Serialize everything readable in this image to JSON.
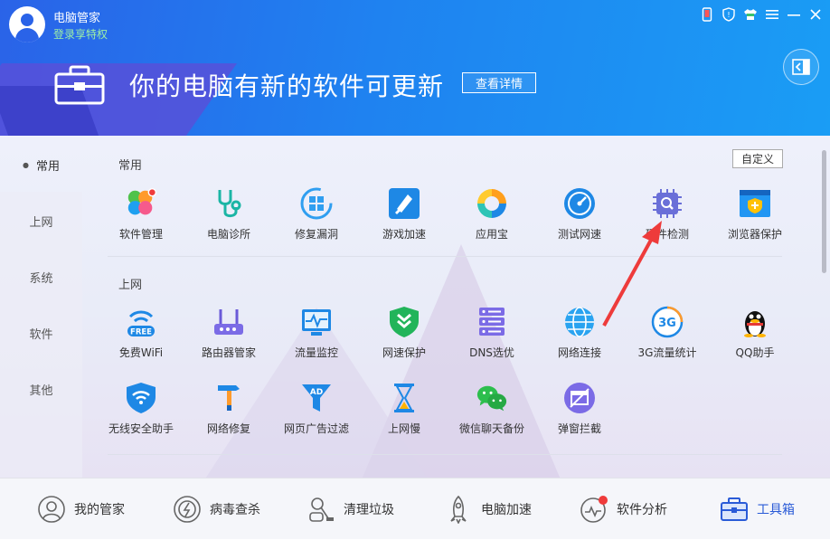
{
  "header": {
    "app_title": "电脑管家",
    "login_link": "登录享特权",
    "headline": "你的电脑有新的软件可更新",
    "detail_button": "查看详情"
  },
  "sidebar": {
    "items": [
      {
        "label": "常用",
        "active": true
      },
      {
        "label": "上网"
      },
      {
        "label": "系统"
      },
      {
        "label": "软件"
      },
      {
        "label": "其他"
      }
    ]
  },
  "main": {
    "custom_button": "自定义",
    "sections": [
      {
        "title": "常用",
        "tools": [
          {
            "label": "软件管理",
            "icon": "software-manager-icon"
          },
          {
            "label": "电脑诊所",
            "icon": "stethoscope-icon"
          },
          {
            "label": "修复漏洞",
            "icon": "windows-repair-icon"
          },
          {
            "label": "游戏加速",
            "icon": "game-boost-icon"
          },
          {
            "label": "应用宝",
            "icon": "app-store-icon"
          },
          {
            "label": "测试网速",
            "icon": "speedometer-icon"
          },
          {
            "label": "硬件检测",
            "icon": "chip-search-icon"
          },
          {
            "label": "浏览器保护",
            "icon": "browser-shield-icon"
          }
        ]
      },
      {
        "title": "上网",
        "tools": [
          {
            "label": "免费WiFi",
            "icon": "free-wifi-icon",
            "badge": "FREE"
          },
          {
            "label": "路由器管家",
            "icon": "router-icon"
          },
          {
            "label": "流量监控",
            "icon": "traffic-monitor-icon"
          },
          {
            "label": "网速保护",
            "icon": "speed-shield-icon"
          },
          {
            "label": "DNS选优",
            "icon": "dns-server-icon"
          },
          {
            "label": "网络连接",
            "icon": "globe-icon"
          },
          {
            "label": "3G流量统计",
            "icon": "3g-icon",
            "badge": "3G"
          },
          {
            "label": "QQ助手",
            "icon": "qq-penguin-icon"
          },
          {
            "label": "无线安全助手",
            "icon": "wifi-shield-icon"
          },
          {
            "label": "网络修复",
            "icon": "hammer-icon"
          },
          {
            "label": "网页广告过滤",
            "icon": "ad-filter-icon",
            "badge": "AD"
          },
          {
            "label": "上网慢",
            "icon": "hourglass-icon"
          },
          {
            "label": "微信聊天备份",
            "icon": "wechat-icon"
          },
          {
            "label": "弹窗拦截",
            "icon": "popup-block-icon"
          }
        ]
      }
    ]
  },
  "bottom_nav": [
    {
      "label": "我的管家",
      "icon": "butler-icon"
    },
    {
      "label": "病毒查杀",
      "icon": "virus-scan-icon"
    },
    {
      "label": "清理垃圾",
      "icon": "vacuum-icon"
    },
    {
      "label": "电脑加速",
      "icon": "rocket-icon"
    },
    {
      "label": "软件分析",
      "icon": "software-analysis-icon"
    },
    {
      "label": "工具箱",
      "icon": "toolbox-icon",
      "active": true
    }
  ],
  "colors": {
    "accent": "#2a63e8",
    "login_green": "#9ef0a5",
    "annotation_arrow": "#ee3b3b"
  }
}
